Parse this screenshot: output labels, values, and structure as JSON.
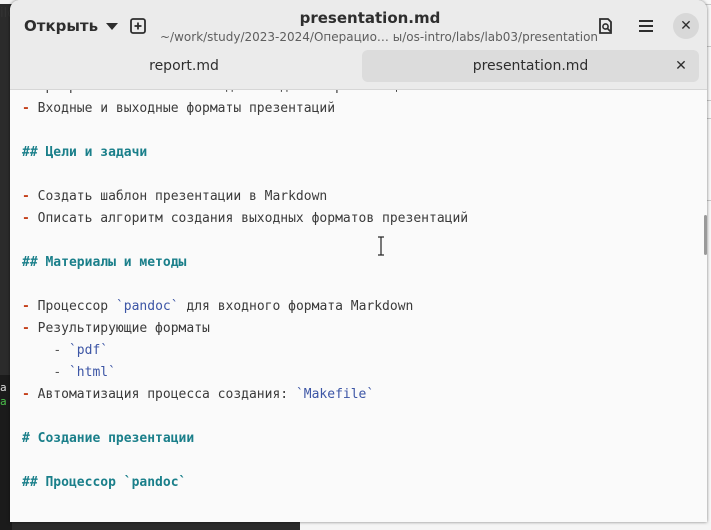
{
  "background": {
    "left_edge_text": "ilo",
    "left_mark_1": "a",
    "left_mark_2": "a",
    "right_lines": [
      4,
      46,
      100,
      118,
      200
    ]
  },
  "header": {
    "open_label": "Открыть",
    "title": "presentation.md",
    "subtitle": "~/work/study/2023-2024/Операцио… ы/os-intro/labs/lab03/presentation"
  },
  "icons": {
    "new_tab": "new-tab-icon",
    "search_doc": "search-document-icon",
    "menu": "hamburger-menu-icon",
    "close": "close-icon"
  },
  "tabs": [
    {
      "label": "report.md",
      "active": false
    },
    {
      "label": "presentation.md",
      "active": true
    }
  ],
  "editor": {
    "lines": [
      {
        "text": "Программное обеспечение для создания презентаций",
        "partial": true
      },
      {
        "bullet": "-",
        "text": "Входные и выходные форматы презентаций"
      },
      {
        "text": ""
      },
      {
        "heading": "## Цели и задачи"
      },
      {
        "text": ""
      },
      {
        "bullet": "-",
        "text": "Создать шаблон презентации в Markdown"
      },
      {
        "bullet": "-",
        "text": "Описать алгоритм создания выходных форматов презентаций"
      },
      {
        "text": ""
      },
      {
        "heading": "## Материалы и методы"
      },
      {
        "text": ""
      },
      {
        "bullet": "-",
        "pre": "Процессор ",
        "code": "`pandoc`",
        "post": " для входного формата Markdown"
      },
      {
        "bullet": "-",
        "text": "Результирующие форматы"
      },
      {
        "indent": "    ",
        "sub": "-",
        "code": "`pdf`"
      },
      {
        "indent": "    ",
        "sub": "-",
        "code": "`html`"
      },
      {
        "bullet": "-",
        "pre": "Автоматизация процесса создания: ",
        "code": "`Makefile`"
      },
      {
        "text": ""
      },
      {
        "heading": "# Создание презентации"
      },
      {
        "text": ""
      },
      {
        "heading": "## Процессор `pandoc`"
      }
    ]
  },
  "colors": {
    "bullet": "#c4401a",
    "heading": "#1a7f8a",
    "code": "#3c55a5"
  }
}
